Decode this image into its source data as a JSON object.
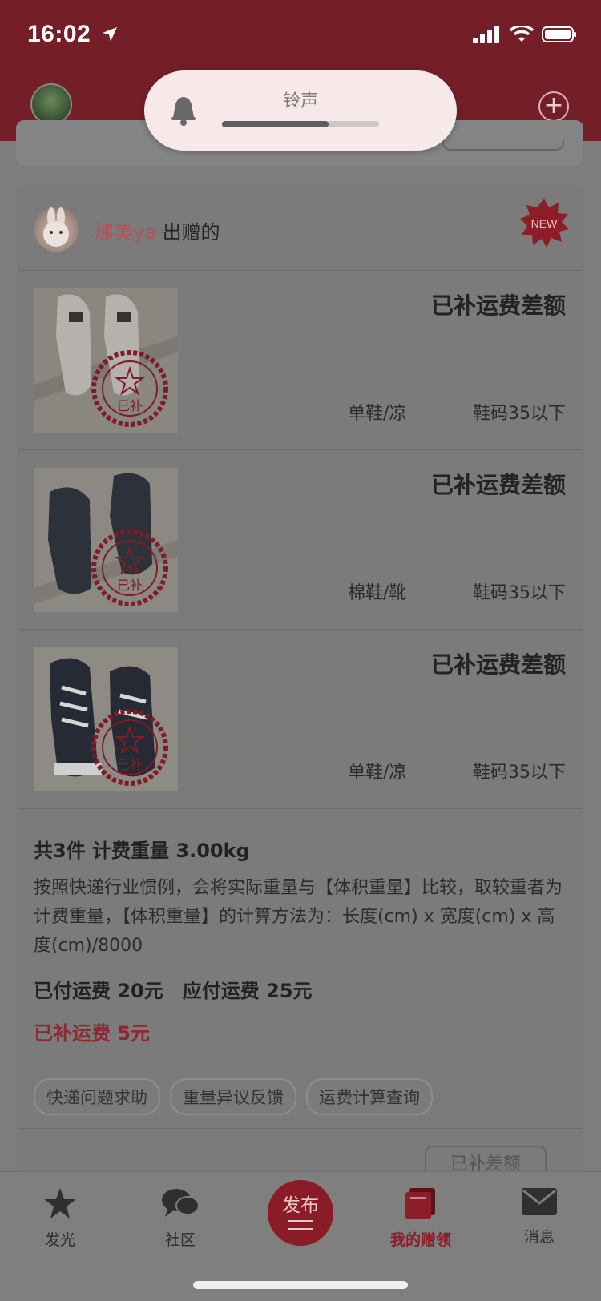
{
  "status_bar": {
    "time": "16:02",
    "icons": [
      "location-arrow-icon",
      "signal-icon",
      "wifi-icon",
      "battery-icon"
    ]
  },
  "volume_hud": {
    "label": "铃声",
    "level": 0.68
  },
  "card": {
    "giver_name": "娜美ya",
    "giver_suffix": "出赠的",
    "badge": "NEW",
    "items": [
      {
        "status": "已补运费差额",
        "category": "单鞋/凉",
        "size": "鞋码35以下",
        "stamp": "已补"
      },
      {
        "status": "已补运费差额",
        "category": "棉鞋/靴",
        "size": "鞋码35以下",
        "stamp": "已补"
      },
      {
        "status": "已补运费差额",
        "category": "单鞋/凉",
        "size": "鞋码35以下",
        "stamp": "已补"
      }
    ],
    "summary": {
      "title": "共3件 计费重量 3.00kg",
      "description": "按照快递行业惯例，会将实际重量与【体积重量】比较，取较重者为计费重量，【体积重量】的计算方法为：长度(cm) x 宽度(cm) x 高度(cm)/8000",
      "paid": "已付运费 20元",
      "due": "应付运费 25元",
      "diff": "已补运费 5元"
    },
    "chips": [
      "快递问题求助",
      "重量异议反馈",
      "运费计算查询"
    ],
    "action_button": "已补差额"
  },
  "tabbar": {
    "tabs": [
      {
        "label": "发光",
        "icon": "star-icon",
        "active": false
      },
      {
        "label": "社区",
        "icon": "chat-bubbles-icon",
        "active": false
      },
      {
        "label": "我的赠领",
        "icon": "book-stack-icon",
        "active": true
      },
      {
        "label": "消息",
        "icon": "envelope-icon",
        "active": false
      }
    ],
    "publish_label": "发布"
  },
  "colors": {
    "header": "#741f27",
    "accent": "#8b1e28",
    "dim_overlay": "#7b7b7b"
  }
}
